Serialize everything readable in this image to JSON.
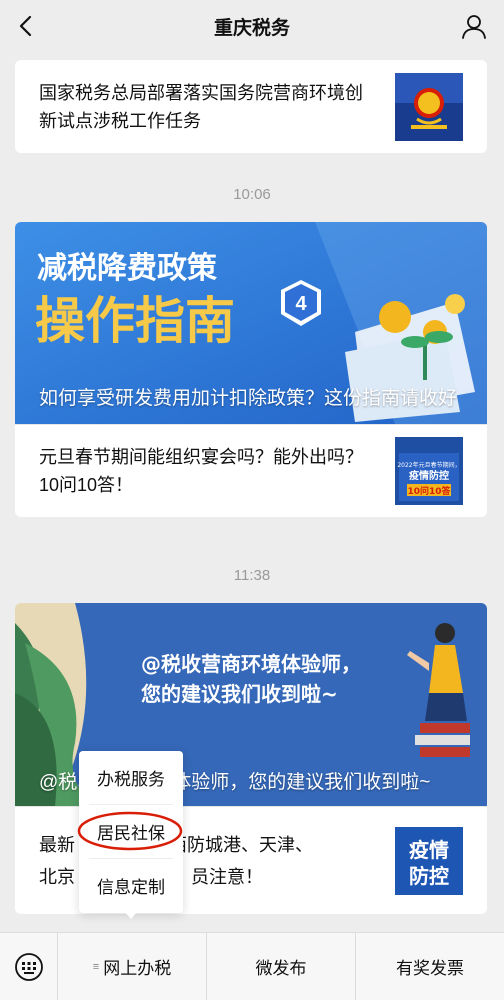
{
  "header": {
    "title": "重庆税务"
  },
  "messages": [
    {
      "text": "国家税务总局部署落实国务院营商环境创新试点涉税工作任务"
    },
    {
      "time": "10:06"
    },
    {
      "banner_title_1": "减税降费政策",
      "banner_title_2": "操作指南",
      "banner_badge": "4",
      "caption": "如何享受研发费用加计扣除政策？这份指南请收好"
    },
    {
      "text": "元旦春节期间能组织宴会吗？能外出吗？10问10答！",
      "thumb_lines": [
        "2022年元旦春节期间，",
        "疫情防控",
        "10问10答"
      ]
    },
    {
      "time": "11:38"
    },
    {
      "banner_text_1": "@税收营商环境体验师，",
      "banner_text_2": "您的建议我们收到啦~",
      "caption": "@税收营商环境体验师，您的建议我们收到啦~"
    },
    {
      "text_before": "最新",
      "text_after": "广西防城港、天津、",
      "text_line2_before": "北京",
      "text_line2_after": "员注意！",
      "thumb_lines": [
        "疫情",
        "防控"
      ]
    }
  ],
  "popup_menu": {
    "items": [
      "办税服务",
      "居民社保",
      "信息定制"
    ]
  },
  "bottom_menu": {
    "items": [
      "网上办税",
      "微发布",
      "有奖发票"
    ],
    "prefix": "≡"
  },
  "colors": {
    "accent_red": "#d81e06",
    "banner_blue": "#2f6fd6",
    "gold": "#f3b61f"
  }
}
